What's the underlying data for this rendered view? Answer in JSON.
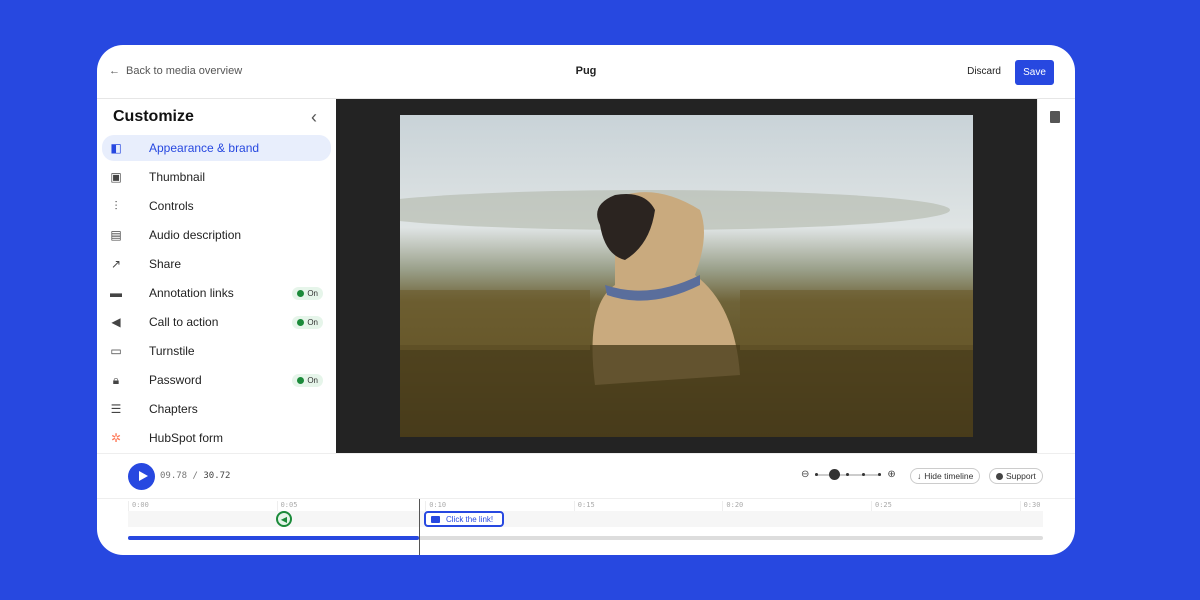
{
  "header": {
    "back_label": "Back to media overview",
    "title": "Pug",
    "discard_label": "Discard",
    "save_label": "Save"
  },
  "sidebar": {
    "title": "Customize",
    "items": [
      {
        "label": "Appearance & brand",
        "icon": "appearance-icon",
        "active": true
      },
      {
        "label": "Thumbnail",
        "icon": "image-icon"
      },
      {
        "label": "Controls",
        "icon": "sliders-icon"
      },
      {
        "label": "Audio description",
        "icon": "audio-description-icon"
      },
      {
        "label": "Share",
        "icon": "share-icon"
      },
      {
        "label": "Annotation links",
        "icon": "annotation-link-icon",
        "badge": "On"
      },
      {
        "label": "Call to action",
        "icon": "megaphone-icon",
        "badge": "On"
      },
      {
        "label": "Turnstile",
        "icon": "turnstile-icon"
      },
      {
        "label": "Password",
        "icon": "lock-icon",
        "badge": "On"
      },
      {
        "label": "Chapters",
        "icon": "list-icon"
      },
      {
        "label": "HubSpot form",
        "icon": "hubspot-icon"
      }
    ]
  },
  "player": {
    "current_time": "09.78",
    "separator": "/",
    "duration": "30.72",
    "progress_fraction": 0.318,
    "zoom_level_step": 1,
    "zoom_steps": 5
  },
  "toolbar": {
    "hide_timeline_label": "Hide timeline",
    "support_label": "Support"
  },
  "timeline": {
    "ticks": [
      "0:00",
      "0:05",
      "0:10",
      "0:15",
      "0:20",
      "0:25",
      "0:30"
    ],
    "annotation_label": "Click the link!"
  },
  "colors": {
    "accent": "#2748e0",
    "on_badge": "#1b8a3a",
    "background": "#2748e0"
  }
}
